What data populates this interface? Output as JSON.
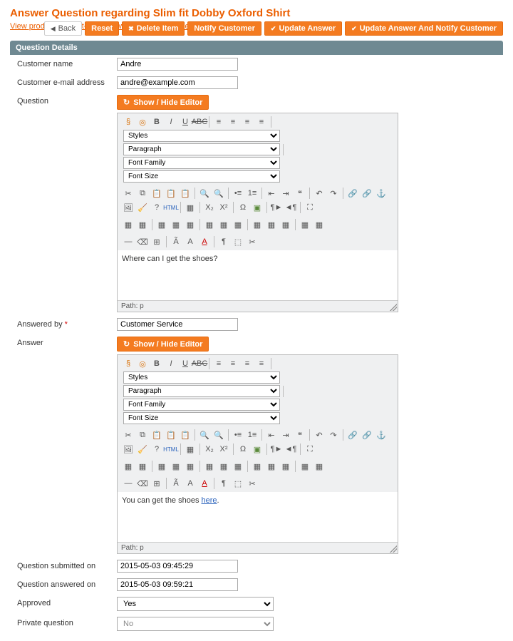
{
  "page_title": "Answer Question regarding Slim fit Dobby Oxford Shirt",
  "links": {
    "front": "View product on front-end",
    "back": "View product on back-end"
  },
  "buttons": {
    "back": "Back",
    "reset": "Reset",
    "delete": "Delete Item",
    "notify": "Notify Customer",
    "update": "Update Answer",
    "update_notify": "Update Answer And Notify Customer"
  },
  "section": "Question Details",
  "labels": {
    "customer_name": "Customer name",
    "customer_email": "Customer e-mail address",
    "question": "Question",
    "answered_by": "Answered by",
    "answer": "Answer",
    "submitted": "Question submitted on",
    "answered": "Question answered on",
    "approved": "Approved",
    "private": "Private question"
  },
  "values": {
    "customer_name": "Andre",
    "customer_email": "andre@example.com",
    "answered_by": "Customer Service",
    "submitted": "2015-05-03 09:45:29",
    "answered": "2015-05-03 09:59:21",
    "approved": "Yes",
    "private": "No"
  },
  "editor": {
    "toggle": "Show / Hide Editor",
    "styles": "Styles",
    "paragraph": "Paragraph",
    "font_family": "Font Family",
    "font_size": "Font Size",
    "path_label": "Path: p"
  },
  "question_body": "Where can I get the shoes?",
  "answer_body_pre": "You can get the shoes ",
  "answer_body_link": "here",
  "answer_body_post": "."
}
